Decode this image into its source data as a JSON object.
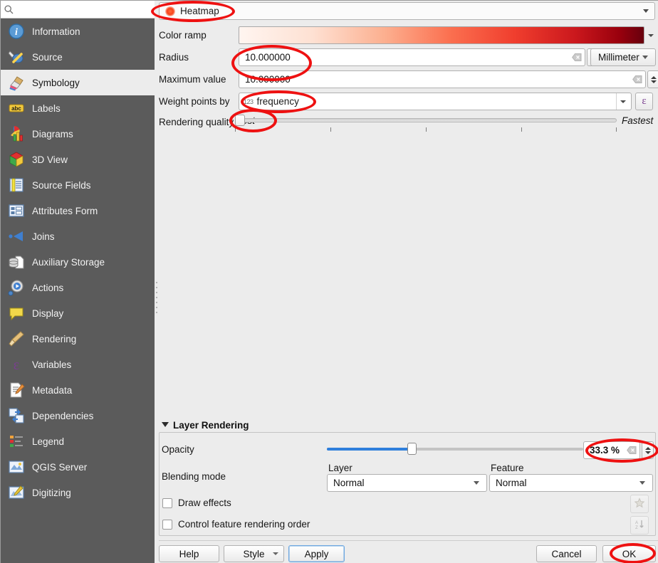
{
  "search": {
    "placeholder": "",
    "value": "",
    "icon": "search-icon"
  },
  "sidebar": {
    "items": [
      {
        "label": "Information",
        "icon": "information-icon",
        "selected": false
      },
      {
        "label": "Source",
        "icon": "source-icon",
        "selected": false
      },
      {
        "label": "Symbology",
        "icon": "symbology-brush-icon",
        "selected": true
      },
      {
        "label": "Labels",
        "icon": "labels-abc-icon",
        "selected": false
      },
      {
        "label": "Diagrams",
        "icon": "diagrams-chart-icon",
        "selected": false
      },
      {
        "label": "3D View",
        "icon": "cube-3d-icon",
        "selected": false
      },
      {
        "label": "Source Fields",
        "icon": "source-fields-icon",
        "selected": false
      },
      {
        "label": "Attributes Form",
        "icon": "attributes-form-icon",
        "selected": false
      },
      {
        "label": "Joins",
        "icon": "joins-icon",
        "selected": false
      },
      {
        "label": "Auxiliary Storage",
        "icon": "auxiliary-storage-icon",
        "selected": false
      },
      {
        "label": "Actions",
        "icon": "actions-gear-icon",
        "selected": false
      },
      {
        "label": "Display",
        "icon": "display-balloon-icon",
        "selected": false
      },
      {
        "label": "Rendering",
        "icon": "rendering-brush-icon",
        "selected": false
      },
      {
        "label": "Variables",
        "icon": "variables-epsilon-icon",
        "selected": false
      },
      {
        "label": "Metadata",
        "icon": "metadata-pencil-icon",
        "selected": false
      },
      {
        "label": "Dependencies",
        "icon": "dependencies-icon",
        "selected": false
      },
      {
        "label": "Legend",
        "icon": "legend-icon",
        "selected": false
      },
      {
        "label": "QGIS Server",
        "icon": "qgis-server-icon",
        "selected": false
      },
      {
        "label": "Digitizing",
        "icon": "digitizing-icon",
        "selected": false
      }
    ]
  },
  "symbology": {
    "renderer": {
      "label": "Heatmap",
      "icon": "heatmap-dot-icon"
    },
    "color_ramp": {
      "label": "Color ramp",
      "stops": [
        "#fff5f0",
        "#fee1d3",
        "#fcaf8f",
        "#fb7050",
        "#f03e2e",
        "#cb181d",
        "#99000d",
        "#67000d"
      ]
    },
    "radius": {
      "label": "Radius",
      "value": "10.000000",
      "unit": "Millimeter"
    },
    "maximum_value": {
      "label": "Maximum value",
      "value": "10.000000"
    },
    "weight_points_by": {
      "label": "Weight points by",
      "value": "frequency",
      "field_type_badge": "123",
      "expression_button": "ε"
    },
    "rendering_quality": {
      "label": "Rendering quality",
      "left_end": "Best",
      "right_end": "Fastest",
      "position_percent": 0
    }
  },
  "layer_rendering": {
    "title": "Layer Rendering",
    "opacity": {
      "label": "Opacity",
      "value": "33.3 %",
      "percent": 33.3
    },
    "blending_mode": {
      "label": "Blending mode",
      "layer_label": "Layer",
      "layer_value": "Normal",
      "feature_label": "Feature",
      "feature_value": "Normal"
    },
    "draw_effects": {
      "label": "Draw effects",
      "checked": false,
      "icon": "effects-star-icon"
    },
    "control_feature_rendering_order": {
      "label": "Control feature rendering order",
      "checked": false,
      "icon": "sort-az-icon"
    }
  },
  "buttons": {
    "help": "Help",
    "style": "Style",
    "apply": "Apply",
    "cancel": "Cancel",
    "ok": "OK"
  },
  "annotations": {
    "color": "#ee1111",
    "highlighted": [
      "Heatmap",
      "10.000000",
      "frequency",
      "Best",
      "33.3 %",
      "OK"
    ]
  }
}
